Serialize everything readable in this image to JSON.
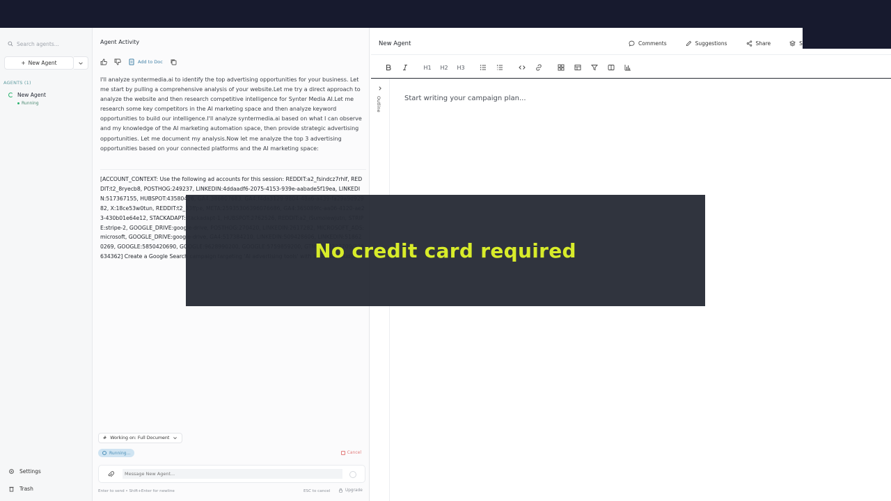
{
  "sidebar": {
    "search_placeholder": "Search agents...",
    "new_agent_label": "New Agent",
    "agents_header": "AGENTS (1)",
    "agents": [
      {
        "name": "New Agent",
        "status": "Running"
      }
    ],
    "settings_label": "Settings",
    "trash_label": "Trash"
  },
  "activity": {
    "title": "Agent Activity",
    "add_to_doc_label": "Add to Doc",
    "message": "I'll analyze syntermedia.ai to identify the top advertising opportunities for your business. Let me start by pulling a comprehensive analysis of your website.Let me try a direct approach to analyze the website and then research competitive intelligence for Synter Media AI.Let me research some key competitors in the AI marketing space and then analyze keyword opportunities to build our intelligence.I'll analyze syntermedia.ai based on what I can observe and my knowledge of the AI marketing automation space, then provide strategic advertising opportunities. Let me document my analysis.Now let me analyze the top 3 advertising opportunities based on your connected platforms and the AI marketing space:",
    "context": "[ACCOUNT_CONTEXT: Use the following ad accounts for this session: REDDIT:a2_fsindcz7rhlf, REDDIT:t2_8ryecb8, POSTHOG:249237, LINKEDIN:4ddaadf6-2075-4153-939e-aabade5f19ea, LINKEDIN:517367155, HUBSPOT:43580426, GA4:386807683, GA4:f4da3129-9804-48a6-a439-fa29a9d92982, X:18ce53w0tun, REDDIT:t2_33ffpe, META:25935306396076686, GA4:365089fc-aa06-4120-ae23-430b01e64e12, STACKADAPT:stackadapt-1, HUBSPOT:2762526, REDDIT:a2_iSumoiewjutn, STRIPE:stripe-2, GOOGLE_DRIVE:google-drive, POSTHOG:270420, LINKEDIN:2617282, MICROSOFT_ADS:microsoft, GOOGLE_DRIVE:google-drive, GA4:517384210, LINKEDIN:509428606, LINKEDIN:518620269, GOOGLE:5850420690, GOOGLE:9628990200, GOOGLE:5759859200, GTM:6330227709/238634362] Create a Google Search campaign targeting 'AI advertising tools' with $100/day budget",
    "working_on_label": "Working on: Full Document",
    "running_label": "Running...",
    "cancel_label": "Cancel",
    "composer_placeholder": "Message New Agent...",
    "hint": "Enter to send • Shift+Enter for newline",
    "esc_hint": "ESC to cancel",
    "upgrade_label": "Upgrade"
  },
  "editor": {
    "title": "New Agent",
    "actions": {
      "comments": "Comments",
      "suggestions": "Suggestions",
      "share": "Share",
      "sessions": "Ses"
    },
    "toolbar": {
      "h1": "H1",
      "h2": "H2",
      "h3": "H3"
    },
    "outline_label": "Outline",
    "placeholder": "Start writing your campaign plan..."
  },
  "overlay": {
    "text": "No credit card required",
    "text_color": "#d8ec2a",
    "background": "#282c36"
  }
}
